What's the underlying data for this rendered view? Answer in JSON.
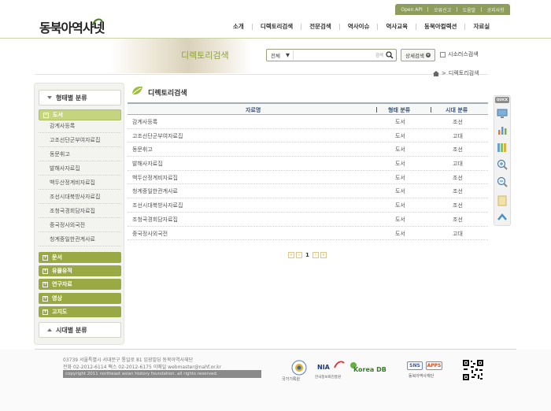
{
  "utility": [
    "Open API",
    "오류신고",
    "도움말",
    "공지사항"
  ],
  "logo": "동북아역사넷",
  "gnb": [
    "소개",
    "디렉토리검색",
    "전문검색",
    "역사이슈",
    "역사교육",
    "동북아컬렉션",
    "자료실"
  ],
  "banner_text": "디렉토리검색",
  "search": {
    "scope": "전체",
    "value": "",
    "button_label": "검색",
    "advanced_label": "상세검색",
    "thesaurus_label": "시소러스검색"
  },
  "breadcrumb": [
    "디렉토리검색"
  ],
  "sidebar": {
    "top_heading": "형태별 분류",
    "active_category": "도서",
    "active_items": [
      "감계사등록",
      "고조선단군부여자료집",
      "동문휘고",
      "발해사자료집",
      "백두산정계비자료집",
      "조선시대북방사자료집",
      "조청국경회담자료집",
      "중국정사외국전",
      "청계중일한관계사료"
    ],
    "other_categories": [
      "문서",
      "유물유적",
      "연구자료",
      "영상",
      "고지도"
    ],
    "bottom_heading": "시대별 분류"
  },
  "main": {
    "title": "디렉토리검색",
    "columns": [
      "자료명",
      "형태 분류",
      "시대 분류"
    ],
    "rows": [
      {
        "name": "감계사등록",
        "type": "도서",
        "era": "조선"
      },
      {
        "name": "고조선단군부여자료집",
        "type": "도서",
        "era": "고대"
      },
      {
        "name": "동문휘고",
        "type": "도서",
        "era": "조선"
      },
      {
        "name": "발해사자료집",
        "type": "도서",
        "era": "고대"
      },
      {
        "name": "백두산정계비자료집",
        "type": "도서",
        "era": "조선"
      },
      {
        "name": "청계중일한관계사료",
        "type": "도서",
        "era": "조선"
      },
      {
        "name": "조선시대북방사자료집",
        "type": "도서",
        "era": "조선"
      },
      {
        "name": "조청국경회담자료집",
        "type": "도서",
        "era": "조선"
      },
      {
        "name": "중국정사외국전",
        "type": "도서",
        "era": "고대"
      }
    ],
    "current_page": "1"
  },
  "quick_label": "QUICK",
  "footer": {
    "address": "03739 서울특별시 서대문구 통일로 81 임광빌딩 동북아역사재단",
    "contact": "전화 02-2012-6114 팩스 02-2012-6175 이메일 webmaster@nahf.or.kr",
    "copyright": "copyright 2011 northeast asian history foundation. all rights reserved.",
    "logos": [
      "국가기록원",
      "NIA",
      "한국정보화진흥원",
      "Korea DB",
      "SNS",
      "APPS",
      "동북아역사재단"
    ]
  },
  "colors": {
    "accent": "#9aa944",
    "accent_light": "#c5d47f",
    "banner_text": "#8ca23c",
    "header_text": "#3a5478"
  }
}
